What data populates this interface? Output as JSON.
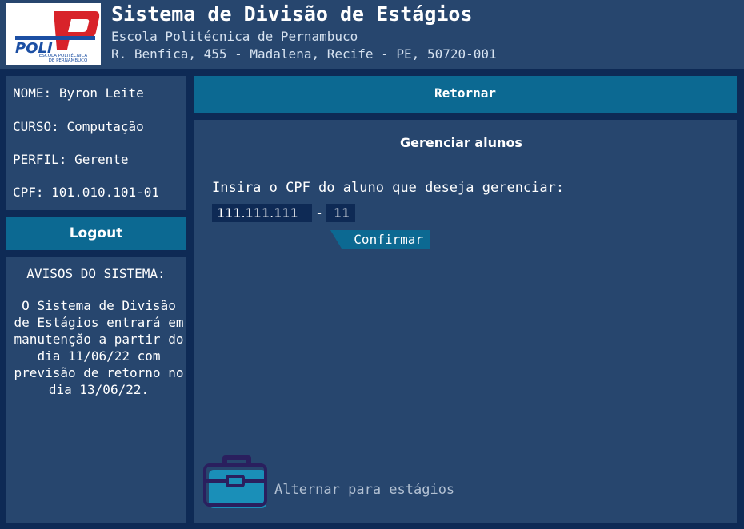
{
  "header": {
    "logo_text": "POLI",
    "logo_caption_line1": "ESCOLA POLITÉCNICA",
    "logo_caption_line2": "DE PERNAMBUCO",
    "title": "Sistema de Divisão de Estágios",
    "school": "Escola Politécnica de Pernambuco",
    "address": "R. Benfica, 455 - Madalena, Recife - PE, 50720-001"
  },
  "user": {
    "name_label": "NOME:",
    "name": "Byron Leite",
    "course_label": "CURSO:",
    "course": "Computação",
    "profile_label": "PERFIL:",
    "profile": "Gerente",
    "cpf_label": "CPF:",
    "cpf": "101.010.101-01"
  },
  "sidebar": {
    "logout_label": "Logout",
    "notices_title": "AVISOS DO SISTEMA:",
    "notices_text": "O Sistema de Divisão de Estágios entrará em manutenção a partir do dia 11/06/22 com previsão de retorno no dia 13/06/22."
  },
  "main": {
    "return_label": "Retornar",
    "title": "Gerenciar alunos",
    "prompt": "Insira o CPF do aluno que deseja gerenciar:",
    "cpf_main_value": "111.111.111",
    "cpf_separator": "-",
    "cpf_digits_value": "11",
    "confirm_label": "Confirmar",
    "switch_label": "Alternar para estágios",
    "switch_icon": "briefcase-icon"
  },
  "colors": {
    "background": "#0e2a55",
    "panel": "#27466e",
    "accent": "#0c6992",
    "icon_fill": "#1a8fb8",
    "icon_stroke": "#2a1f5e"
  }
}
